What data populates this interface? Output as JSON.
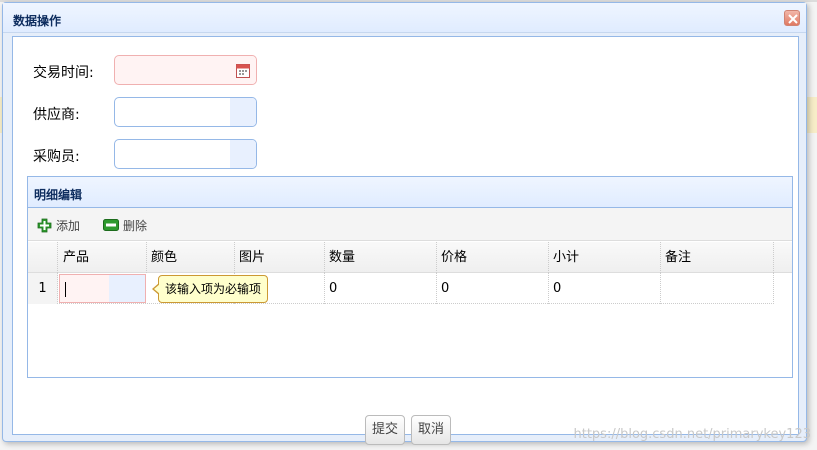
{
  "dialog": {
    "title": "数据操作"
  },
  "form": {
    "trade_time": {
      "label": "交易时间:",
      "value": ""
    },
    "supplier": {
      "label": "供应商:",
      "value": ""
    },
    "buyer": {
      "label": "采购员:",
      "value": ""
    }
  },
  "detail_panel": {
    "title": "明细编辑",
    "toolbar": {
      "add_label": "添加",
      "delete_label": "删除"
    },
    "columns": [
      "产品",
      "颜色",
      "图片",
      "数量",
      "价格",
      "小计",
      "备注"
    ],
    "rows": [
      {
        "row_number": "1",
        "product": "",
        "color": "",
        "image": "",
        "quantity": "0",
        "price": "0",
        "subtotal": "0",
        "remark": ""
      }
    ],
    "validation_tooltip": "该输入项为必输项"
  },
  "buttons": {
    "submit": "提交",
    "cancel": "取消"
  },
  "watermark": "https://blog.csdn.net/primarykey123",
  "colors": {
    "accent": "#95b8e7",
    "title_text": "#0e2d5f",
    "invalid": "#f0b0b0",
    "tooltip_bg": "#ffffcc"
  }
}
